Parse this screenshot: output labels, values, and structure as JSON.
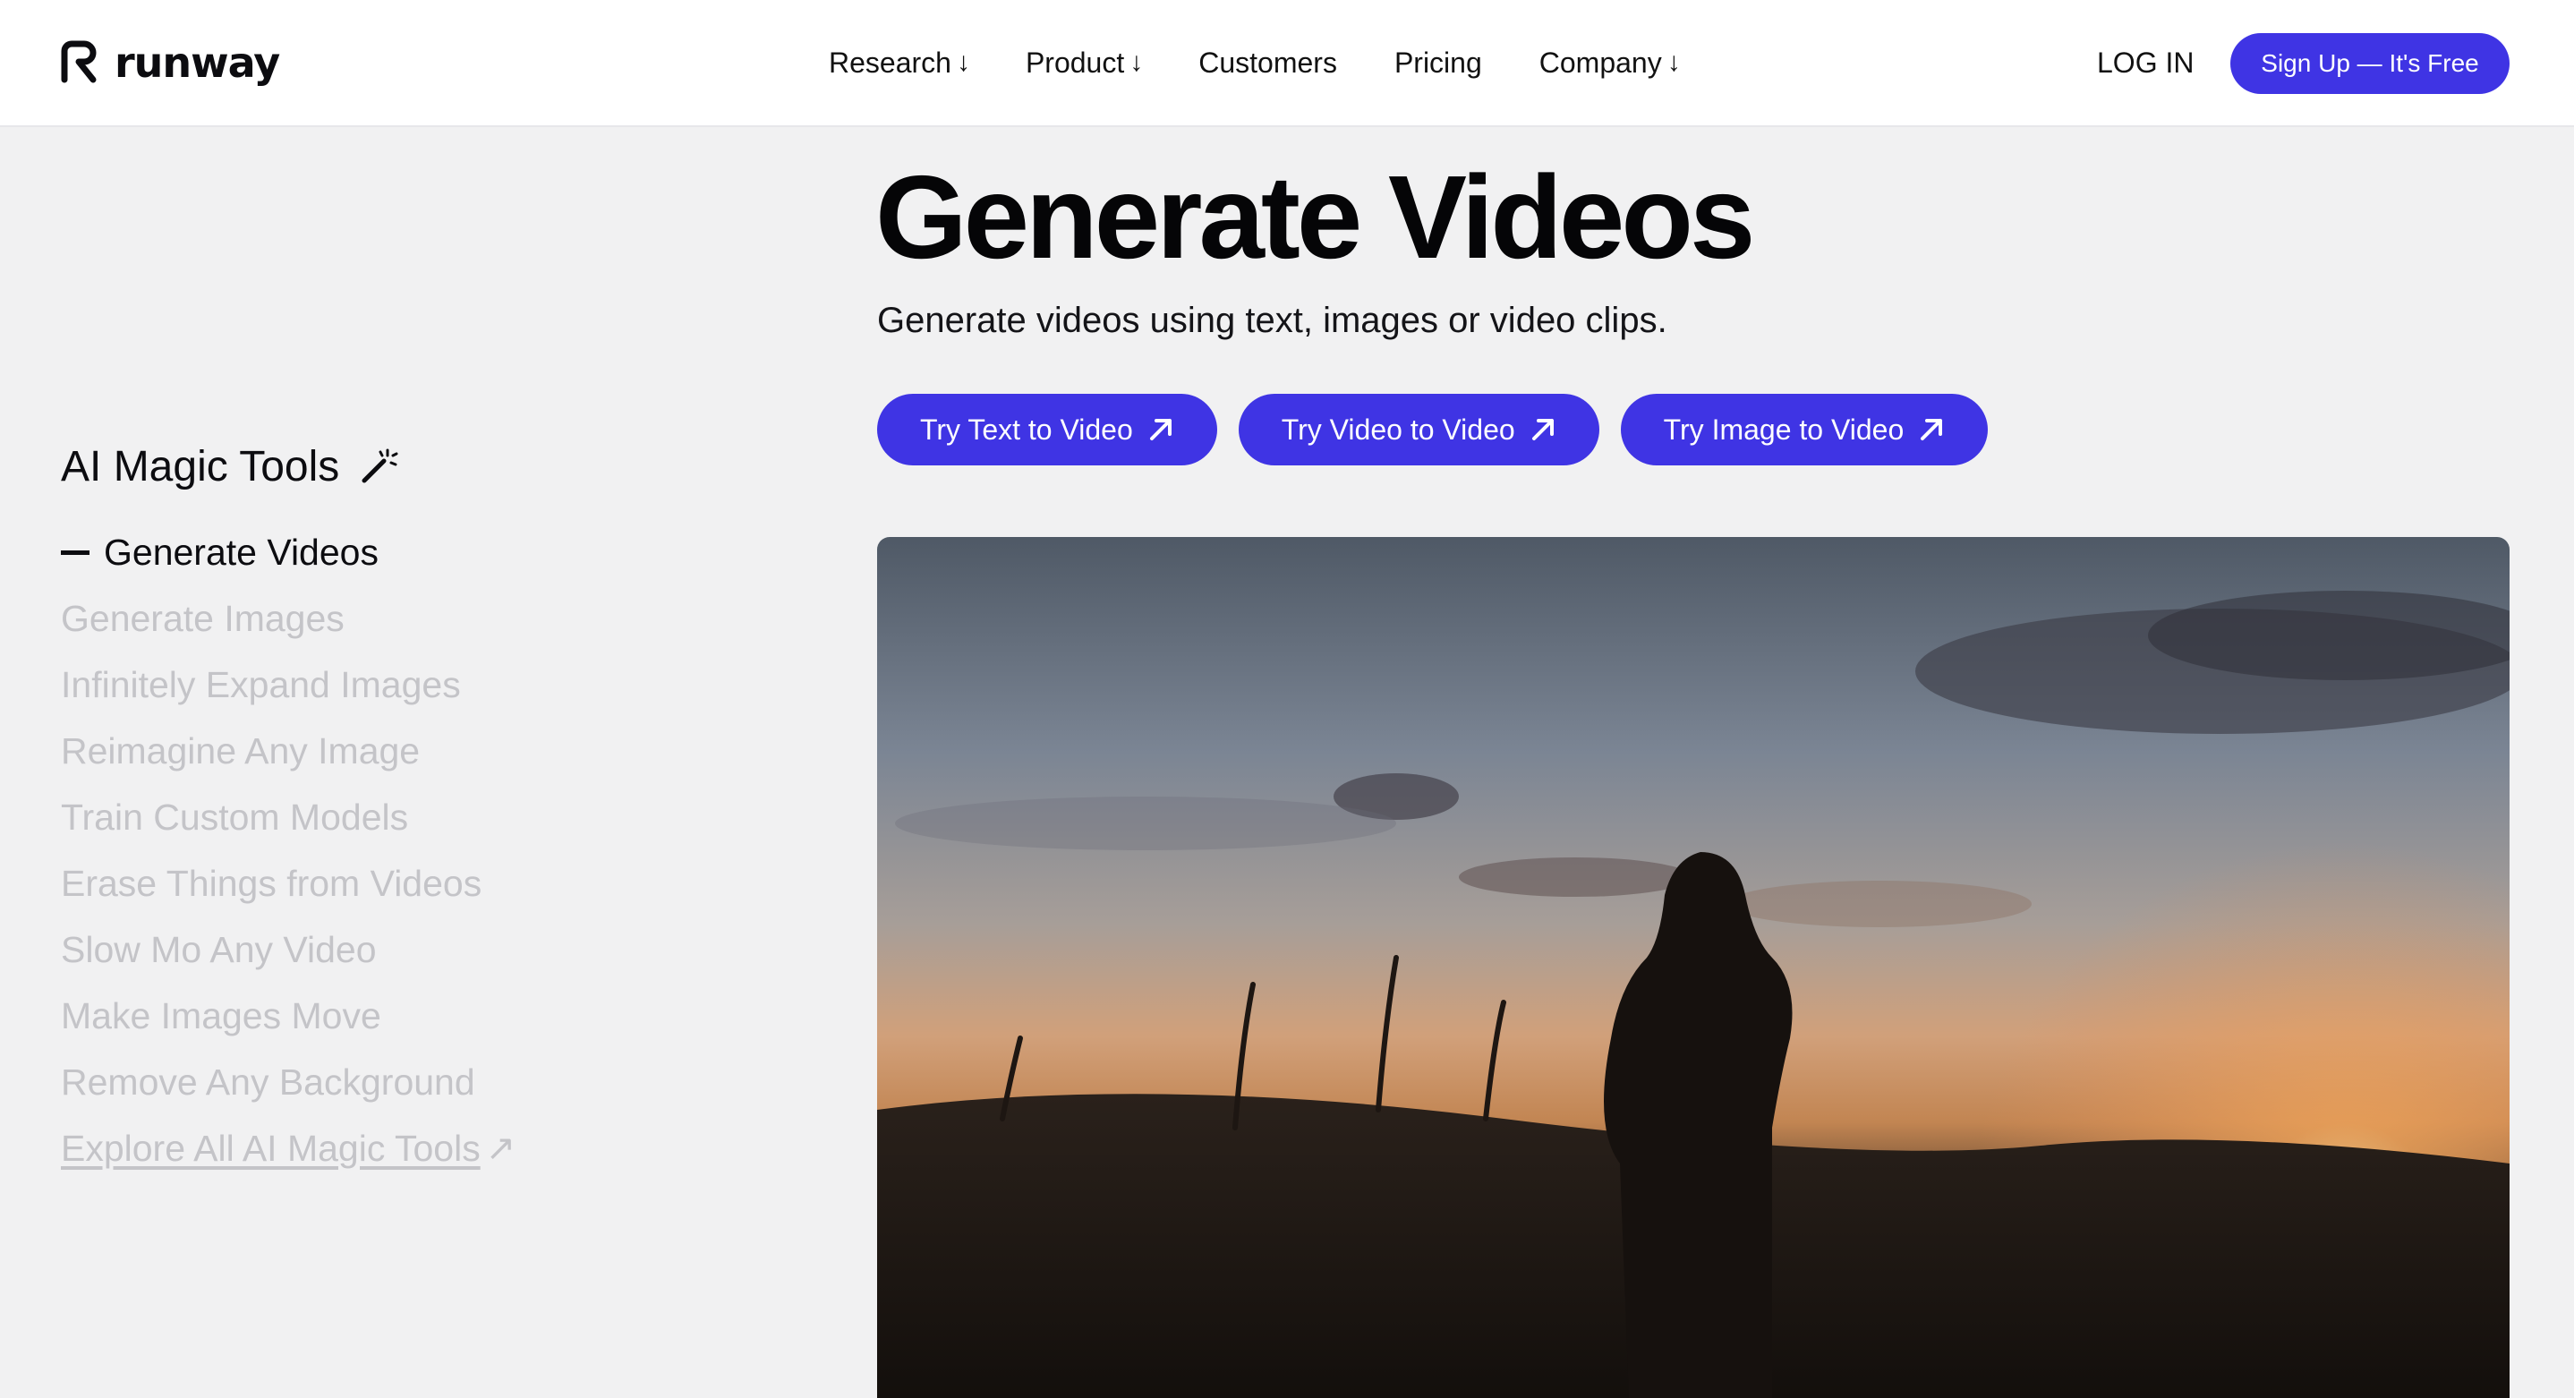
{
  "header": {
    "logo_text": "runway",
    "nav": [
      {
        "label": "Research",
        "arrow": "↓"
      },
      {
        "label": "Product",
        "arrow": "↓"
      },
      {
        "label": "Customers"
      },
      {
        "label": "Pricing"
      },
      {
        "label": "Company",
        "arrow": "↓"
      }
    ],
    "login_label": "LOG IN",
    "signup_label": "Sign Up — It's Free"
  },
  "sidebar": {
    "title": "AI Magic Tools",
    "title_icon": "magic-wand-icon",
    "items": [
      {
        "label": "Generate Videos",
        "active": true
      },
      {
        "label": "Generate Images"
      },
      {
        "label": "Infinitely Expand Images"
      },
      {
        "label": "Reimagine Any Image"
      },
      {
        "label": "Train Custom Models"
      },
      {
        "label": "Erase Things from Videos"
      },
      {
        "label": "Slow Mo Any Video"
      },
      {
        "label": "Make Images Move"
      },
      {
        "label": "Remove Any Background"
      }
    ],
    "explore_label": "Explore All AI Magic Tools",
    "explore_icon": "↗"
  },
  "main": {
    "title": "Generate Videos",
    "subtitle": "Generate videos using text, images or video clips.",
    "ctas": [
      {
        "label": "Try Text to Video"
      },
      {
        "label": "Try Video to Video"
      },
      {
        "label": "Try Image to Video"
      }
    ]
  },
  "colors": {
    "accent": "#3f34e4",
    "background": "#f1f1f2",
    "inactive_text": "#c4c4c8"
  }
}
